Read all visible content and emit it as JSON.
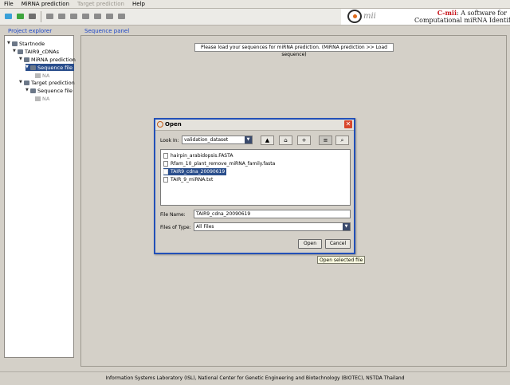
{
  "menu": [
    "File",
    "MiRNA prediction",
    "Target prediction",
    "Help"
  ],
  "banner": {
    "logo_text": "mii",
    "line1_red": "C-mii",
    "line1_rest": ": A software for",
    "line2": "Computational miRNA Identification"
  },
  "explorer": {
    "title": "Project explorer",
    "nodes": [
      "Startnode",
      "TAIR9_cDNAs",
      "MiRNA prediction",
      "Sequence file",
      "NA",
      "Target prediction",
      "Sequence file",
      "NA"
    ]
  },
  "sequence_panel": {
    "title": "Sequence panel",
    "message": "Please load your sequences for miRNA prediction. (MiRNA prediction >> Load sequence)"
  },
  "dialog": {
    "title": "Open",
    "look_in_label": "Look In:",
    "look_in_value": "validation_dataset",
    "files": [
      "hairpin_arabidopsis.FASTA",
      "Rfam_10_plant_remove_miRNA_family.fasta",
      "TAIR9_cdna_20090619",
      "TAIR_9_miRNA.txt"
    ],
    "selected_file": "TAIR9_cdna_20090619",
    "file_name_label": "File Name:",
    "file_name_value": "TAIR9_cdna_20090619",
    "files_of_type_label": "Files of Type:",
    "files_of_type_value": "All Files",
    "open_button": "Open",
    "cancel_button": "Cancel"
  },
  "tooltip": "Open selected file",
  "footer": "Information Systems Laboratory (ISL), National Center for Genetic Engineering and Biotechnology (BIOTEC), NSTDA Thailand"
}
